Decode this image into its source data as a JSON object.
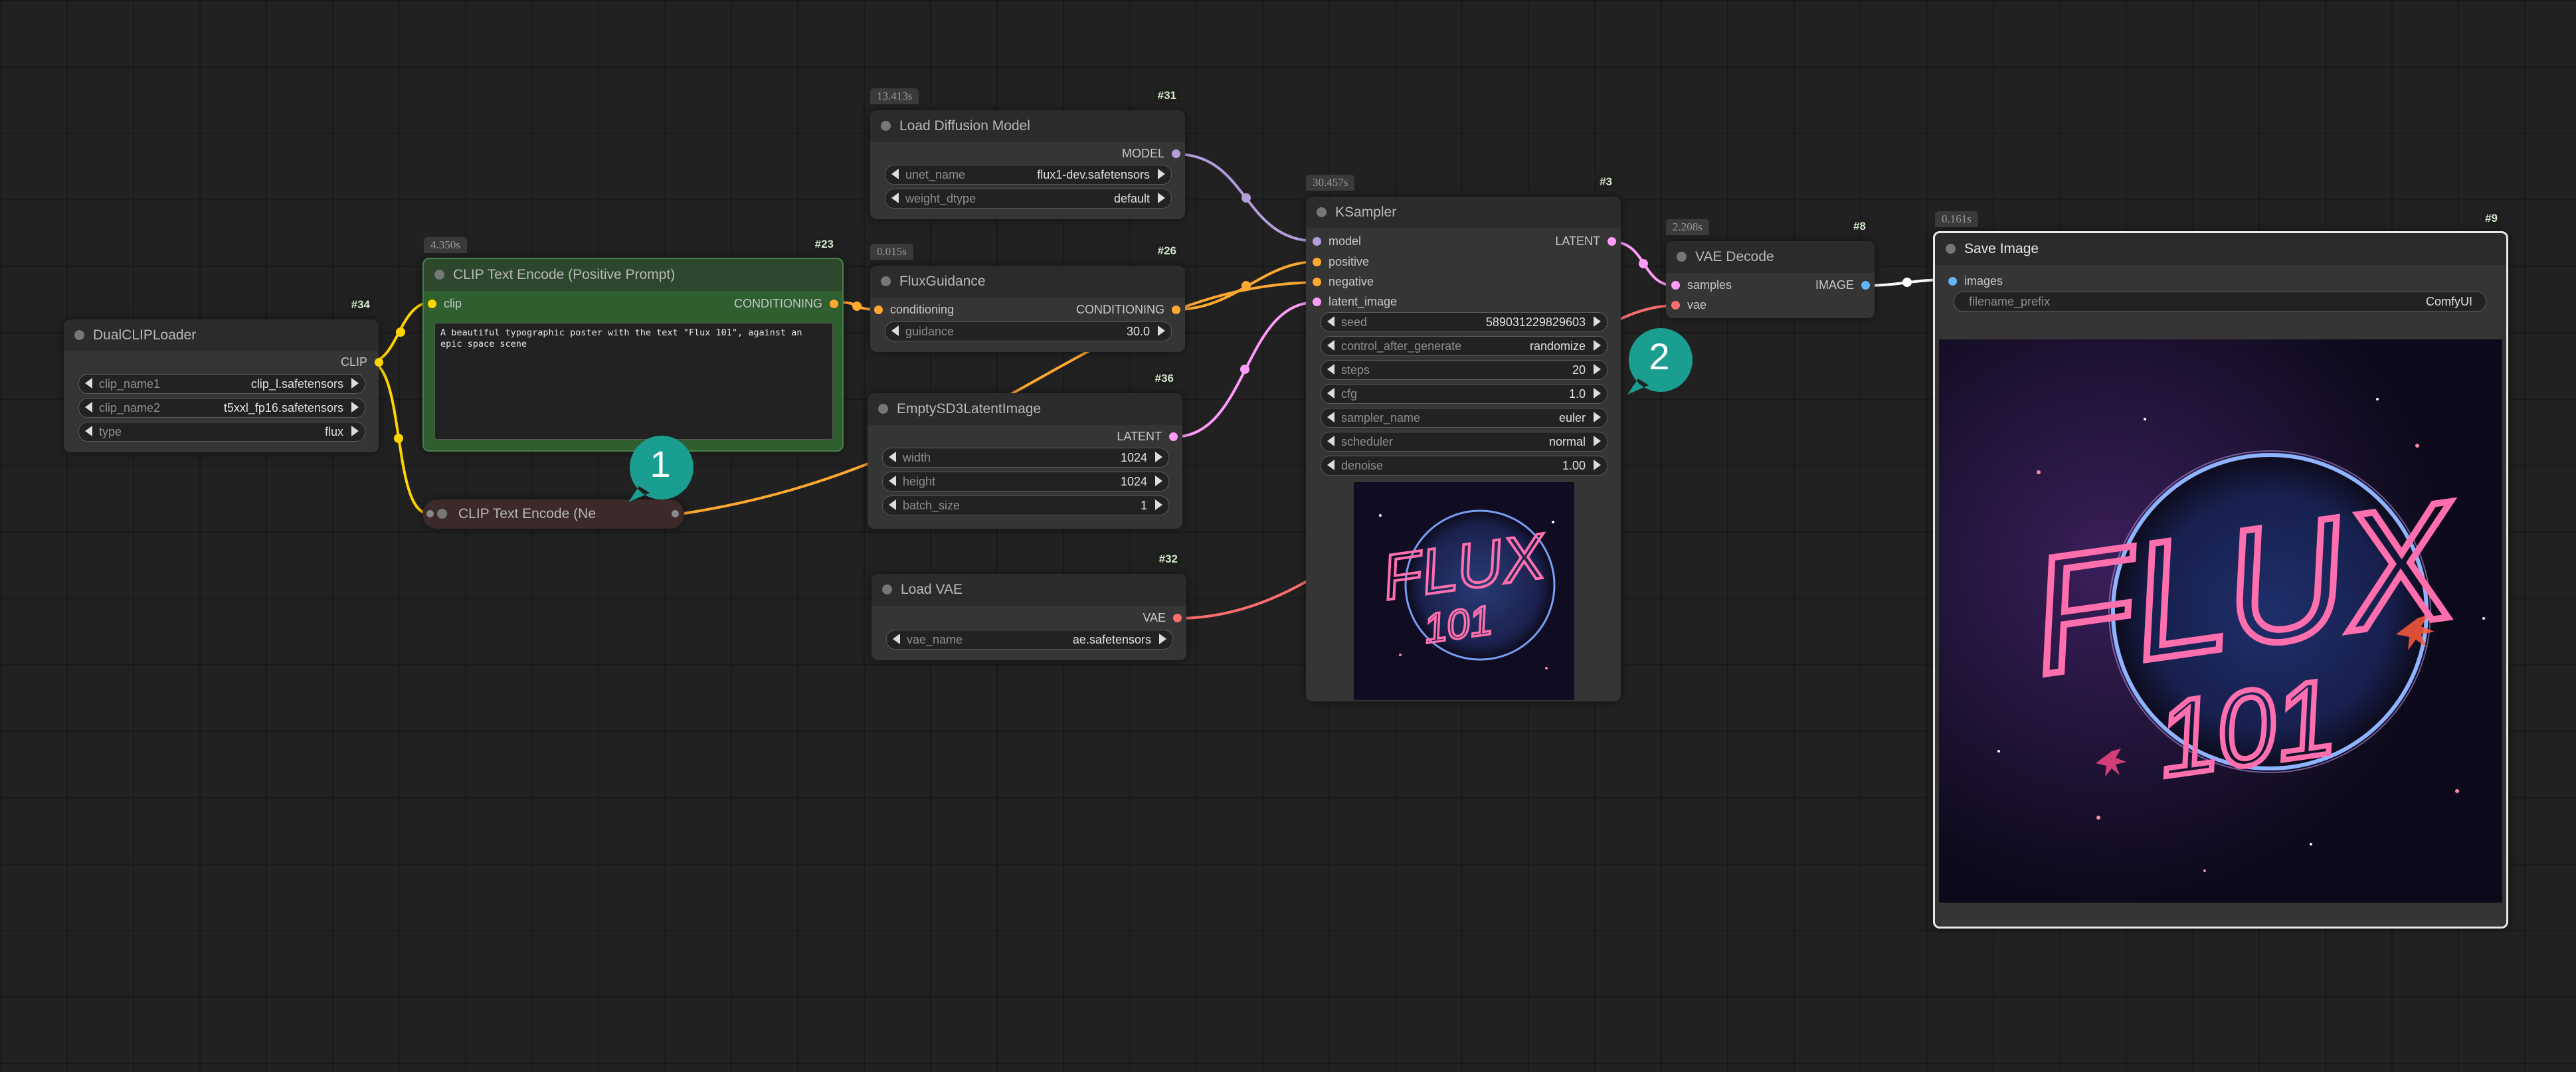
{
  "colors": {
    "background": "#212121",
    "model_link": "#b39ddb",
    "clip_link": "#ffd500",
    "conditioning_link": "#ffa931",
    "latent_link": "#ff9cf9",
    "vae_link": "#ff6e6e",
    "image_link": "#64b5f6",
    "badge": "#1a9e8f"
  },
  "nodes": {
    "dual_clip_loader": {
      "id": "#34",
      "title": "DualCLIPLoader",
      "output": "CLIP",
      "widgets": [
        {
          "name": "clip_name1",
          "value": "clip_l.safetensors"
        },
        {
          "name": "clip_name2",
          "value": "t5xxl_fp16.safetensors"
        },
        {
          "name": "type",
          "value": "flux"
        }
      ]
    },
    "clip_text_positive": {
      "id": "#23",
      "time": "4.350s",
      "title": "CLIP Text Encode (Positive Prompt)",
      "input": "clip",
      "output": "CONDITIONING",
      "text": "A beautiful typographic poster with the text \"Flux 101\", against an epic space scene"
    },
    "clip_text_negative": {
      "title": "CLIP Text Encode (Ne"
    },
    "load_diffusion_model": {
      "id": "#31",
      "time": "13.413s",
      "title": "Load Diffusion Model",
      "output": "MODEL",
      "widgets": [
        {
          "name": "unet_name",
          "value": "flux1-dev.safetensors"
        },
        {
          "name": "weight_dtype",
          "value": "default"
        }
      ]
    },
    "flux_guidance": {
      "id": "#26",
      "time": "0.015s",
      "title": "FluxGuidance",
      "input": "conditioning",
      "output": "CONDITIONING",
      "widgets": [
        {
          "name": "guidance",
          "value": "30.0"
        }
      ]
    },
    "empty_latent": {
      "id": "#36",
      "title": "EmptySD3LatentImage",
      "output": "LATENT",
      "widgets": [
        {
          "name": "width",
          "value": "1024"
        },
        {
          "name": "height",
          "value": "1024"
        },
        {
          "name": "batch_size",
          "value": "1"
        }
      ]
    },
    "load_vae": {
      "id": "#32",
      "title": "Load VAE",
      "output": "VAE",
      "widgets": [
        {
          "name": "vae_name",
          "value": "ae.safetensors"
        }
      ]
    },
    "ksampler": {
      "id": "#3",
      "time": "30.457s",
      "title": "KSampler",
      "inputs": [
        "model",
        "positive",
        "negative",
        "latent_image"
      ],
      "output": "LATENT",
      "widgets": [
        {
          "name": "seed",
          "value": "589031229829603"
        },
        {
          "name": "control_after_generate",
          "value": "randomize"
        },
        {
          "name": "steps",
          "value": "20"
        },
        {
          "name": "cfg",
          "value": "1.0"
        },
        {
          "name": "sampler_name",
          "value": "euler"
        },
        {
          "name": "scheduler",
          "value": "normal"
        },
        {
          "name": "denoise",
          "value": "1.00"
        }
      ]
    },
    "vae_decode": {
      "id": "#8",
      "time": "2.208s",
      "title": "VAE Decode",
      "inputs": [
        "samples",
        "vae"
      ],
      "output": "IMAGE"
    },
    "save_image": {
      "id": "#9",
      "time": "0.161s",
      "title": "Save Image",
      "input": "images",
      "widgets": [
        {
          "name": "filename_prefix",
          "value": "ComfyUI"
        }
      ]
    }
  },
  "preview": {
    "line1": "FLUX",
    "line2": "101"
  },
  "badges": [
    "1",
    "2"
  ]
}
